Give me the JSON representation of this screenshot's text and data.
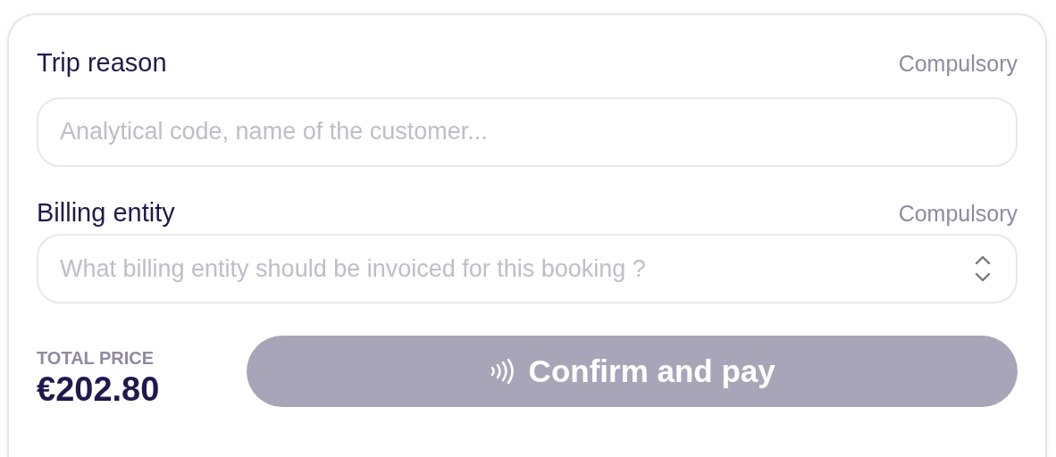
{
  "fields": [
    {
      "kind": "text",
      "label": "Trip reason",
      "note": "Compulsory",
      "placeholder": "Analytical code, name of the customer..."
    },
    {
      "kind": "select",
      "label": "Billing entity",
      "note": "Compulsory",
      "placeholder": "What billing entity should be invoiced for this booking ?"
    }
  ],
  "total": {
    "label": "TOTAL PRICE",
    "amount": "€202.80"
  },
  "pay_button": {
    "label": "Confirm and pay",
    "disabled": true
  }
}
